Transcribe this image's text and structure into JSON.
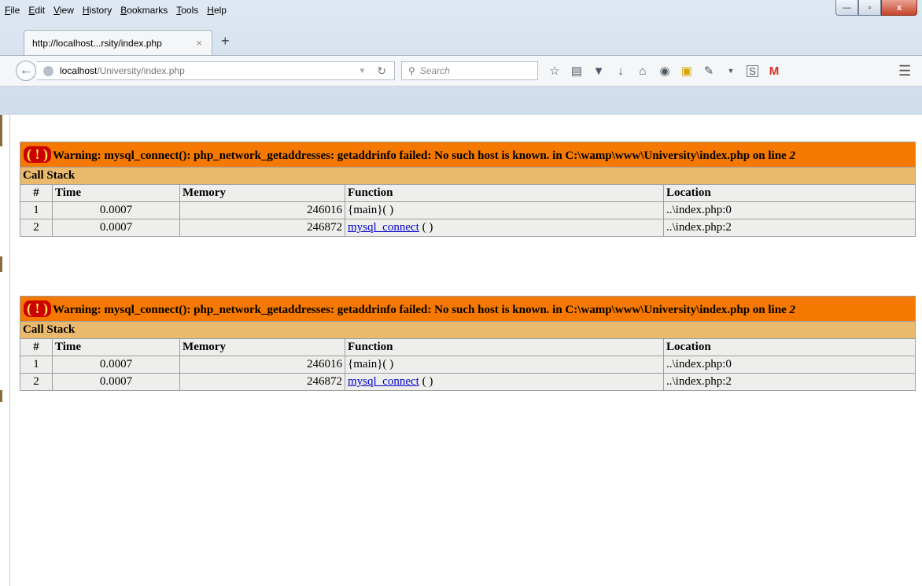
{
  "menu": [
    "File",
    "Edit",
    "View",
    "History",
    "Bookmarks",
    "Tools",
    "Help"
  ],
  "window_buttons": {
    "minimize": "—",
    "maximize": "▫",
    "close": "x"
  },
  "tab": {
    "title": "http://localhost...rsity/index.php",
    "close": "×",
    "new": "+"
  },
  "address": {
    "host": "localhost",
    "path": "/University/index.php"
  },
  "search": {
    "placeholder": "Search"
  },
  "toolbar_icons": [
    "star-icon",
    "reading-list-icon",
    "pocket-icon",
    "download-icon",
    "home-icon",
    "chat-icon",
    "screenshot-icon",
    "pen-icon",
    "dropdown-icon",
    "s-icon",
    "gmail-icon"
  ],
  "errors": [
    {
      "icon": "( ! )",
      "message": "Warning: mysql_connect(): php_network_getaddresses: getaddrinfo failed: No such host is known. in C:\\wamp\\www\\University\\index.php on line ",
      "line": "2",
      "stack_title": "Call Stack",
      "columns": [
        "#",
        "Time",
        "Memory",
        "Function",
        "Location"
      ],
      "rows": [
        {
          "num": "1",
          "time": "0.0007",
          "memory": "246016",
          "function": "{main}( )",
          "link": "",
          "location": "..\\index.php:0"
        },
        {
          "num": "2",
          "time": "0.0007",
          "memory": "246872",
          "function": " ( )",
          "link": "mysql_connect",
          "location": "..\\index.php:2"
        }
      ]
    },
    {
      "icon": "( ! )",
      "message": "Warning: mysql_connect(): php_network_getaddresses: getaddrinfo failed: No such host is known. in C:\\wamp\\www\\University\\index.php on line ",
      "line": "2",
      "stack_title": "Call Stack",
      "columns": [
        "#",
        "Time",
        "Memory",
        "Function",
        "Location"
      ],
      "rows": [
        {
          "num": "1",
          "time": "0.0007",
          "memory": "246016",
          "function": "{main}( )",
          "link": "",
          "location": "..\\index.php:0"
        },
        {
          "num": "2",
          "time": "0.0007",
          "memory": "246872",
          "function": " ( )",
          "link": "mysql_connect",
          "location": "..\\index.php:2"
        }
      ]
    }
  ]
}
